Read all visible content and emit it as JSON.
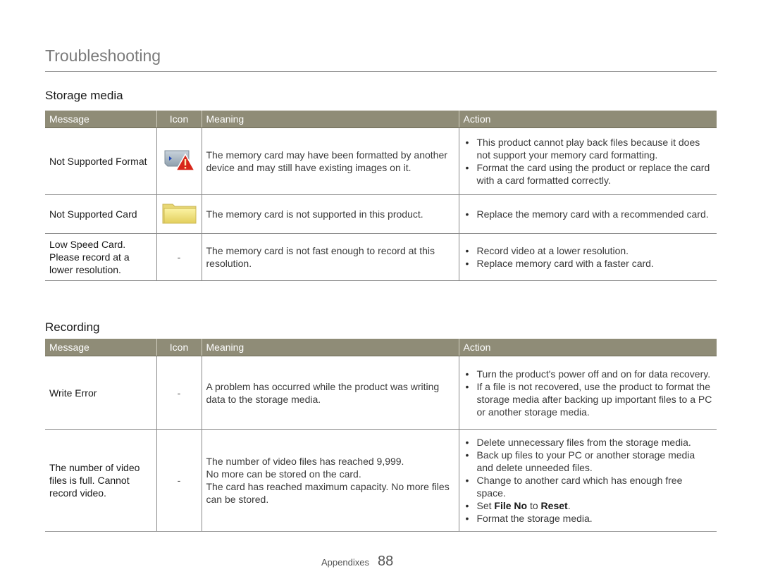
{
  "page": {
    "title": "Troubleshooting",
    "footer": {
      "section": "Appendixes",
      "page_number": "88"
    }
  },
  "columns": {
    "message": "Message",
    "icon": "Icon",
    "meaning": "Meaning",
    "action": "Action"
  },
  "storage": {
    "heading": "Storage media",
    "rows": [
      {
        "message": "Not Supported Format",
        "icon": "memory-card-warning-icon",
        "meaning": "The memory card may have been formatted by another device and may still have existing images on it.",
        "actions": [
          "This product cannot play back files because it does not support your memory card formatting.",
          "Format the card using the product or replace the card with a card formatted correctly."
        ]
      },
      {
        "message": "Not Supported Card",
        "icon": "folder-icon",
        "meaning": "The memory card is not supported in this product.",
        "actions": [
          "Replace the memory card with a recommended card."
        ]
      },
      {
        "message": "Low Speed Card. Please record at a lower resolution.",
        "icon_text": "-",
        "meaning": "The memory card is not fast enough to record at this resolution.",
        "actions": [
          "Record video at a lower resolution.",
          "Replace memory card with a faster card."
        ]
      }
    ]
  },
  "recording": {
    "heading": "Recording",
    "rows": [
      {
        "message": "Write Error",
        "icon_text": "-",
        "meaning": "A problem has occurred while the product was writing data to the storage media.",
        "actions": [
          "Turn the product's power off and on for data recovery.",
          "If a file is not recovered, use the product to format the storage media after backing up important files to a PC or another storage media."
        ]
      },
      {
        "message": "The number of video files is full. Cannot record video.",
        "icon_text": "-",
        "meaning_lines": [
          "The number of video files has reached 9,999.",
          "No more can be stored on the card.",
          "The card has reached maximum capacity. No more files can be stored."
        ],
        "actions": [
          "Delete unnecessary files from the storage media.",
          "Back up files to your PC or another storage media and delete unneeded files.",
          "Change to another card which has enough free space."
        ],
        "action_setting": {
          "prefix": "Set ",
          "setting": "File No",
          "middle": " to ",
          "value": "Reset",
          "suffix": "."
        },
        "action_last": "Format the storage media."
      }
    ]
  }
}
